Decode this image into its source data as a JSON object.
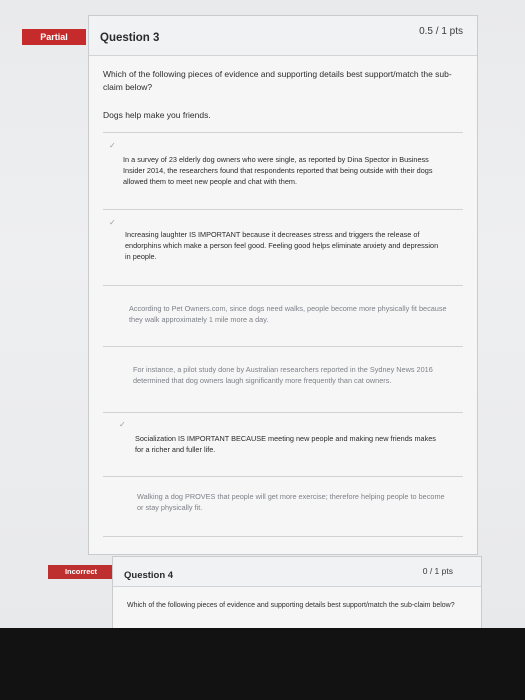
{
  "question3": {
    "badge": "Partial",
    "title": "Question 3",
    "points": "0.5 / 1 pts",
    "prompt": "Which of the following pieces of evidence and supporting details best support/match the sub-claim below?",
    "subclaim": "Dogs help make you friends.",
    "answers": [
      {
        "text": "In a survey of 23 elderly dog owners who were single, as reported by Dina Spector in Business Insider 2014, the researchers found that respondents reported that being outside with their dogs allowed them to meet new people and chat with them.",
        "selected": true
      },
      {
        "text": "Increasing laughter IS IMPORTANT because it decreases stress and triggers the release of endorphins which make a person feel good. Feeling good helps eliminate anxiety and depression in people.",
        "selected": true
      },
      {
        "text": "According to Pet Owners.com, since dogs need walks, people become more physically fit because they walk approximately 1 mile more a day.",
        "selected": false
      },
      {
        "text": "For instance, a pilot study done by Australian researchers reported in the Sydney News 2016 determined that dog owners laugh significantly more frequently than cat owners.",
        "selected": false
      },
      {
        "text": "Socialization IS IMPORTANT BECAUSE meeting new people and making new friends makes for a richer and fuller life.",
        "selected": true
      },
      {
        "text": "Walking a dog PROVES that people will get more exercise; therefore helping people to become or stay physically fit.",
        "selected": false
      }
    ]
  },
  "question4": {
    "badge": "Incorrect",
    "title": "Question 4",
    "points": "0 / 1 pts",
    "prompt": "Which of the following pieces of evidence and supporting details best support/match the sub-claim below?"
  }
}
